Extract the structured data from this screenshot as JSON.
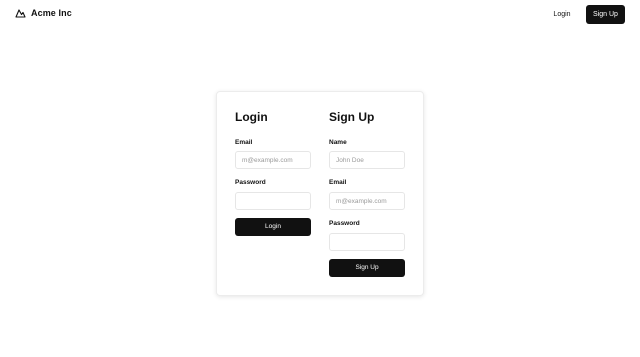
{
  "header": {
    "brand_name": "Acme Inc",
    "brand_icon": "mountain-icon",
    "login_label": "Login",
    "signup_label": "Sign Up"
  },
  "login": {
    "title": "Login",
    "email_label": "Email",
    "email_placeholder": "m@example.com",
    "password_label": "Password",
    "submit_label": "Login"
  },
  "signup": {
    "title": "Sign Up",
    "name_label": "Name",
    "name_placeholder": "John Doe",
    "email_label": "Email",
    "email_placeholder": "m@example.com",
    "password_label": "Password",
    "submit_label": "Sign Up"
  },
  "colors": {
    "primary": "#111111",
    "border": "#e6e6e6",
    "placeholder": "#9a9a9a"
  }
}
